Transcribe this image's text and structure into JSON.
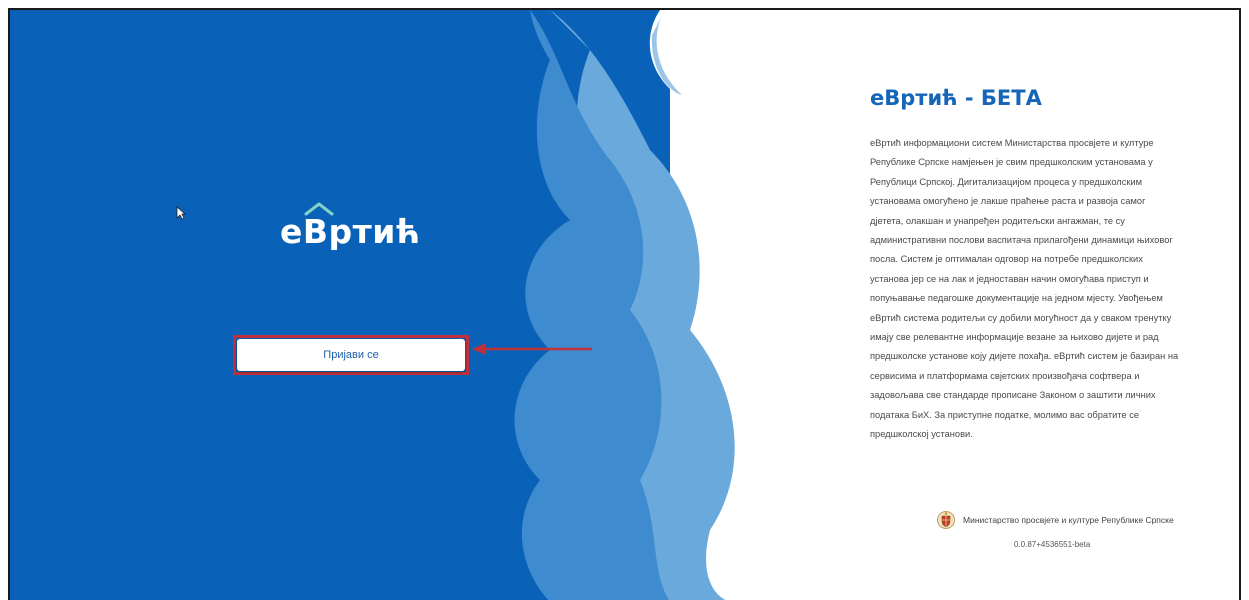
{
  "app": {
    "logo_text": "eВртић"
  },
  "login": {
    "button_label": "Пријави се"
  },
  "info": {
    "title": "eВртић - БЕТА",
    "description": "eВртић информациони систем Министарства просвјете и културе Републике Српске намјењен је свим предшколским установама у Републици Српској. Дигитализацијом процеса у предшколским установама омогућено је лакше праћење раста и развоја самог дјетета, олакшан и унапређен родитељски ангажман, те су административни послови васпитача прилагођени динамици њиховог посла. Систем је оптималан одговор на потребе предшколских установа јер се на лак и једноставан начин омогућава приступ и попуњавање педагошке документације на једном мјесту. Увођењем eВртић система родитељи су добили могућност да у сваком тренутку имају све релевантне информације везане за њихово дијете и рад предшколске установе коју дијете похађа. eВртић систем је базиран на сервисима и платформама свјетских произвођача софтвера и задовољава све стандарде прописане Законом о заштити личних података БиХ. За приступне податке, молимо вас обратите се предшколској установи."
  },
  "footer": {
    "ministry": "Министарство просвјете и културе Републике Српске",
    "version": "0.0.87+4536551-beta"
  },
  "colors": {
    "primary_blue": "#0a62b8",
    "accent_title": "#1565b8",
    "highlight_red": "#c0303a"
  },
  "icons": {
    "cursor": "mouse-pointer-icon",
    "arrow": "red-arrow-annotation",
    "crest": "coat-of-arms-icon"
  }
}
